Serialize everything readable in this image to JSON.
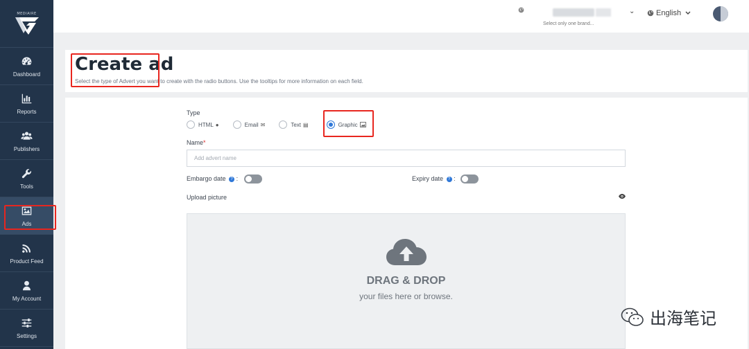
{
  "sidebar": {
    "logo_text": "MEDIAIRE",
    "items": [
      {
        "label": "Dashboard",
        "icon": "dashboard-icon"
      },
      {
        "label": "Reports",
        "icon": "bar-chart-icon"
      },
      {
        "label": "Publishers",
        "icon": "users-icon"
      },
      {
        "label": "Tools",
        "icon": "wrench-icon"
      },
      {
        "label": "Ads",
        "icon": "image-icon",
        "active": true
      },
      {
        "label": "Product Feed",
        "icon": "rss-icon"
      },
      {
        "label": "My Account",
        "icon": "user-icon"
      },
      {
        "label": "Settings",
        "icon": "sliders-icon"
      }
    ]
  },
  "topbar": {
    "brand_hint": "Select only one brand...",
    "language": "English"
  },
  "page": {
    "title": "Create ad",
    "subtitle": "Select the type of Advert you want to create with the radio buttons. Use the tooltips for more information on each field."
  },
  "form": {
    "type_label": "Type",
    "types": [
      {
        "label": "HTML",
        "icon": "globe-icon",
        "checked": false
      },
      {
        "label": "Email",
        "icon": "envelope-icon",
        "checked": false
      },
      {
        "label": "Text",
        "icon": "document-icon",
        "checked": false
      },
      {
        "label": "Graphic",
        "icon": "image-icon",
        "checked": true
      }
    ],
    "name_label": "Name",
    "name_required": "*",
    "name_placeholder": "Add advert name",
    "embargo_label": "Embargo date",
    "expiry_label": "Expiry date",
    "colon": ":",
    "upload_label": "Upload picture",
    "dropzone_title": "DRAG & DROP",
    "dropzone_sub": "your files here or browse."
  },
  "watermark": {
    "text": "出海笔记"
  },
  "colors": {
    "sidebar_bg": "#22344a",
    "accent": "#2f78d8",
    "highlight": "#e8261f"
  }
}
